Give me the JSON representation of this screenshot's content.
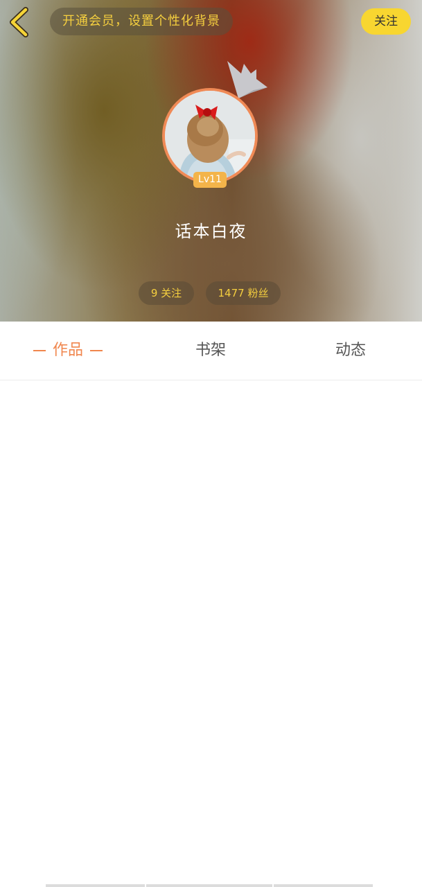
{
  "header": {
    "vip_banner": "开通会员，设置个性化背景",
    "follow_label": "关注",
    "level": "Lv11",
    "username": "话本白夜",
    "stats": {
      "following": "9 关注",
      "fans": "1477 粉丝"
    }
  },
  "tabs": [
    {
      "label": "作品",
      "active": true
    },
    {
      "label": "书架",
      "active": false
    },
    {
      "label": "动态",
      "active": false
    }
  ],
  "colors": {
    "accent": "#f0864d",
    "gold_text": "#f5cf3f",
    "follow_button": "#f8d630",
    "level_badge": "#f3b44a"
  },
  "icons": {
    "back": "back-chevron-icon",
    "crown": "crown-icon"
  }
}
